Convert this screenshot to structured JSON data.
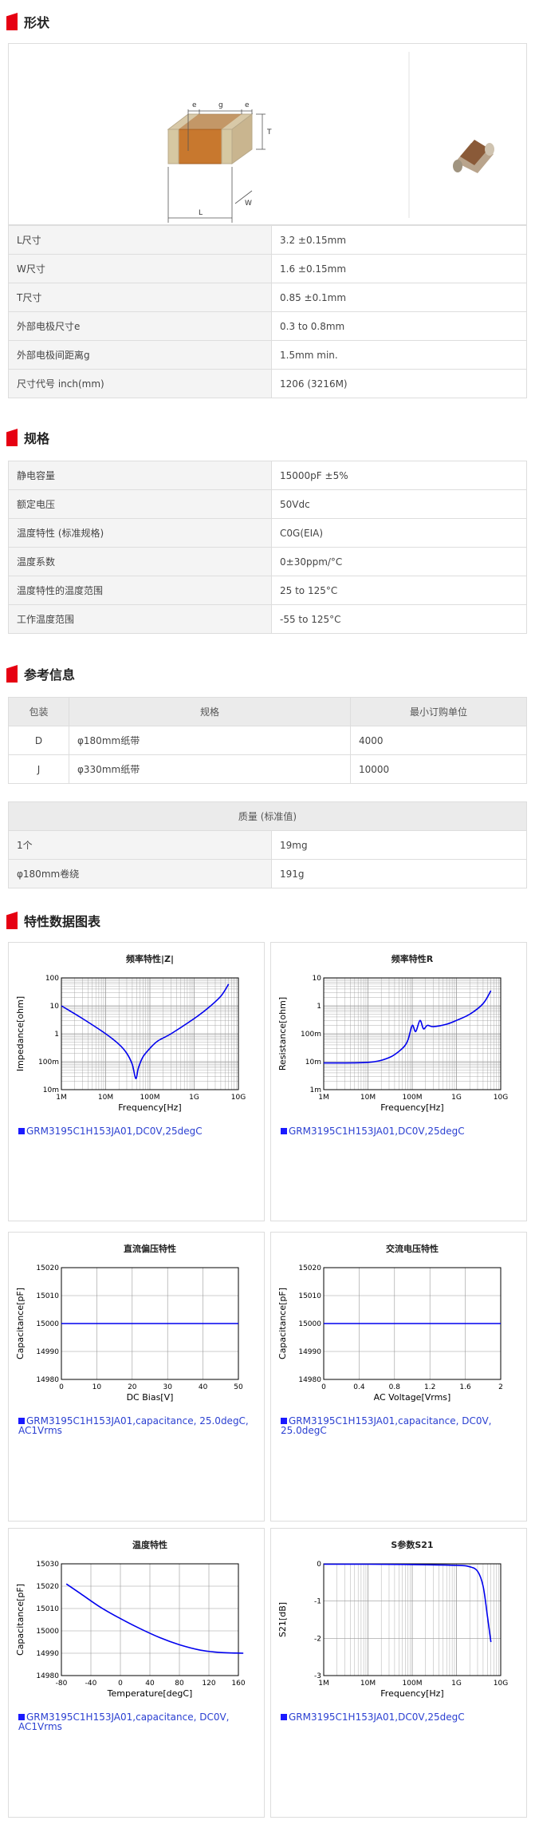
{
  "sections": {
    "shape": "形状",
    "spec": "规格",
    "ref": "参考信息",
    "charts": "特性数据图表"
  },
  "diagram": {
    "e1": "e",
    "g": "g",
    "e2": "e",
    "T": "T",
    "L": "L",
    "W": "W"
  },
  "shape_rows": [
    {
      "k": "L尺寸",
      "v": "3.2 ±0.15mm"
    },
    {
      "k": "W尺寸",
      "v": "1.6 ±0.15mm"
    },
    {
      "k": "T尺寸",
      "v": "0.85 ±0.1mm"
    },
    {
      "k": "外部电极尺寸e",
      "v": "0.3 to 0.8mm"
    },
    {
      "k": "外部电极间距离g",
      "v": "1.5mm min."
    },
    {
      "k": "尺寸代号 inch(mm)",
      "v": "1206 (3216M)"
    }
  ],
  "spec_rows": [
    {
      "k": "静电容量",
      "v": "15000pF ±5%"
    },
    {
      "k": "额定电压",
      "v": "50Vdc"
    },
    {
      "k": "温度特性 (标准规格)",
      "v": "C0G(EIA)"
    },
    {
      "k": "温度系数",
      "v": "0±30ppm/°C"
    },
    {
      "k": "温度特性的温度范围",
      "v": "25 to 125°C"
    },
    {
      "k": "工作温度范围",
      "v": "-55 to 125°C"
    }
  ],
  "pack": {
    "headers": [
      "包装",
      "规格",
      "最小订购单位"
    ],
    "rows": [
      [
        "D",
        "φ180mm纸带",
        "4000"
      ],
      [
        "J",
        "φ330mm纸带",
        "10000"
      ]
    ]
  },
  "mass": {
    "header": "质量 (标准值)",
    "rows": [
      {
        "k": "1个",
        "v": "19mg"
      },
      {
        "k": "φ180mm卷绕",
        "v": "191g"
      }
    ]
  },
  "chart_data": [
    {
      "type": "line",
      "title": "频率特性|Z|",
      "xlabel": "Frequency[Hz]",
      "ylabel": "Impedance[ohm]",
      "xscale": "log",
      "yscale": "log",
      "xticks": [
        "1M",
        "10M",
        "100M",
        "1G",
        "10G"
      ],
      "yticks": [
        "100",
        "10",
        "1",
        "100m",
        "10m"
      ],
      "xlim": [
        1000000.0,
        10000000000.0
      ],
      "ylim": [
        0.01,
        100
      ],
      "x": [
        1000000.0,
        3000000.0,
        10000000.0,
        20000000.0,
        30000000.0,
        40000000.0,
        48000000.0,
        55000000.0,
        70000000.0,
        100000000.0,
        150000000.0,
        300000000.0,
        1000000000.0,
        2000000000.0,
        4000000000.0,
        6000000000.0
      ],
      "y": [
        10,
        3.5,
        1.0,
        0.42,
        0.2,
        0.08,
        0.025,
        0.06,
        0.15,
        0.3,
        0.55,
        1.0,
        3.5,
        8,
        22,
        60
      ],
      "legend": "GRM3195C1H153JA01,DC0V,25degC"
    },
    {
      "type": "line",
      "title": "频率特性R",
      "xlabel": "Frequency[Hz]",
      "ylabel": "Resistance[ohm]",
      "xscale": "log",
      "yscale": "log",
      "xticks": [
        "1M",
        "10M",
        "100M",
        "1G",
        "10G"
      ],
      "yticks": [
        "10",
        "1",
        "100m",
        "10m",
        "1m"
      ],
      "xlim": [
        1000000.0,
        10000000000.0
      ],
      "ylim": [
        0.001,
        10
      ],
      "x": [
        1000000.0,
        10000000.0,
        30000000.0,
        60000000.0,
        80000000.0,
        100000000.0,
        120000000.0,
        150000000.0,
        180000000.0,
        220000000.0,
        300000000.0,
        600000000.0,
        1000000000.0,
        2000000000.0,
        4000000000.0,
        6000000000.0
      ],
      "y": [
        0.009,
        0.0095,
        0.014,
        0.03,
        0.06,
        0.2,
        0.12,
        0.3,
        0.15,
        0.2,
        0.18,
        0.22,
        0.3,
        0.5,
        1.2,
        3.5
      ],
      "legend": "GRM3195C1H153JA01,DC0V,25degC"
    },
    {
      "type": "line",
      "title": "直流偏压特性",
      "xlabel": "DC Bias[V]",
      "ylabel": "Capacitance[pF]",
      "xticks": [
        "0",
        "10",
        "20",
        "30",
        "40",
        "50"
      ],
      "yticks": [
        "15020",
        "15010",
        "15000",
        "14990",
        "14980"
      ],
      "xlim": [
        0,
        50
      ],
      "ylim": [
        14980,
        15020
      ],
      "x": [
        0,
        50
      ],
      "y": [
        15000,
        15000
      ],
      "legend": "GRM3195C1H153JA01,capacitance, 25.0degC, AC1Vrms"
    },
    {
      "type": "line",
      "title": "交流电压特性",
      "xlabel": "AC Voltage[Vrms]",
      "ylabel": "Capacitance[pF]",
      "xticks": [
        "0",
        "0.4",
        "0.8",
        "1.2",
        "1.6",
        "2"
      ],
      "yticks": [
        "15020",
        "15010",
        "15000",
        "14990",
        "14980"
      ],
      "xlim": [
        0,
        2
      ],
      "ylim": [
        14980,
        15020
      ],
      "x": [
        0,
        2
      ],
      "y": [
        15000,
        15000
      ],
      "legend": "GRM3195C1H153JA01,capacitance, DC0V, 25.0degC"
    },
    {
      "type": "line",
      "title": "温度特性",
      "xlabel": "Temperature[degC]",
      "ylabel": "Capacitance[pF]",
      "xticks": [
        "-80",
        "-40",
        "0",
        "40",
        "80",
        "120",
        "160"
      ],
      "yticks": [
        "15030",
        "15020",
        "15010",
        "15000",
        "14990",
        "14980"
      ],
      "xlim": [
        -60,
        120
      ],
      "ylim": [
        14980,
        15030
      ],
      "x": [
        -55,
        -40,
        -20,
        0,
        20,
        40,
        60,
        80,
        100,
        125
      ],
      "y": [
        15021,
        15016.5,
        15010.5,
        15005.5,
        15001,
        14997,
        14993.8,
        14991.5,
        14990.4,
        14990
      ],
      "legend": "GRM3195C1H153JA01,capacitance, DC0V, AC1Vrms"
    },
    {
      "type": "line",
      "title": "S参数S21",
      "xlabel": "Frequency[Hz]",
      "ylabel": "S21[dB]",
      "xscale": "log",
      "xticks": [
        "1M",
        "10M",
        "100M",
        "1G",
        "10G"
      ],
      "yticks": [
        "0",
        "-1",
        "-2",
        "-3"
      ],
      "xlim": [
        1000000.0,
        10000000000.0
      ],
      "ylim": [
        -3,
        0
      ],
      "x": [
        1000000.0,
        10000000.0,
        100000000.0,
        1000000000.0,
        2000000000.0,
        3000000000.0,
        4000000000.0,
        5000000000.0,
        6000000000.0
      ],
      "y": [
        -0.01,
        -0.01,
        -0.02,
        -0.04,
        -0.08,
        -0.2,
        -0.6,
        -1.4,
        -2.1
      ],
      "legend": "GRM3195C1H153JA01,DC0V,25degC"
    }
  ],
  "colors": {
    "accent": "#e60012",
    "curve": "#0000ee",
    "legend": "#2a3fd1"
  }
}
